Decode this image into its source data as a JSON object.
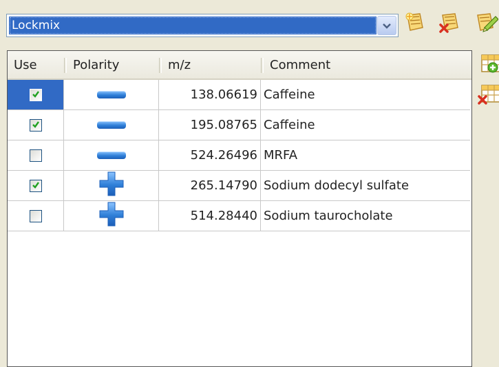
{
  "combo": {
    "selected": "Lockmix"
  },
  "icons": {
    "dropdown_arrow": "chevron-down-icon",
    "toolbar": [
      "new-list-icon",
      "delete-list-icon",
      "edit-list-icon"
    ],
    "side": [
      "add-row-icon",
      "delete-row-icon"
    ]
  },
  "table": {
    "headers": {
      "use": "Use",
      "polarity": "Polarity",
      "mz": "m/z",
      "comment": "Comment"
    },
    "rows": [
      {
        "use": true,
        "polarity": "negative",
        "mz": "138.06619",
        "comment": "Caffeine",
        "selected": true
      },
      {
        "use": true,
        "polarity": "negative",
        "mz": "195.08765",
        "comment": "Caffeine",
        "selected": false
      },
      {
        "use": false,
        "polarity": "negative",
        "mz": "524.26496",
        "comment": "MRFA",
        "selected": false
      },
      {
        "use": true,
        "polarity": "positive",
        "mz": "265.14790",
        "comment": "Sodium dodecyl sulfate",
        "selected": false
      },
      {
        "use": false,
        "polarity": "positive",
        "mz": "514.28440",
        "comment": "Sodium taurocholate",
        "selected": false
      }
    ]
  },
  "colors": {
    "selection": "#316ac5",
    "polarity_blue": "#2f7fd8"
  }
}
